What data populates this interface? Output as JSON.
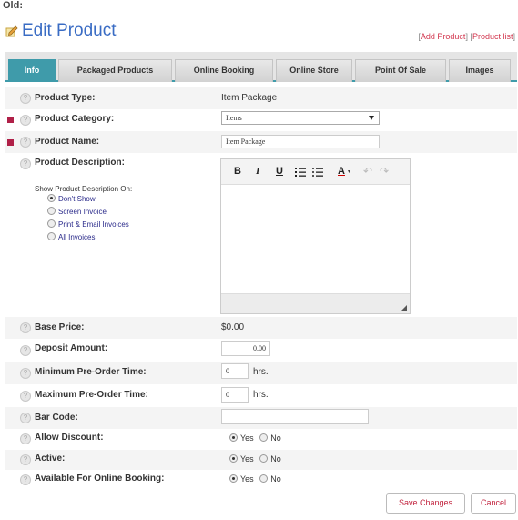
{
  "header": {
    "old_label": "Old:"
  },
  "page": {
    "title": "Edit Product",
    "links": {
      "add_product": "Add Product",
      "product_list": "Product list",
      "open": "[",
      "sep": "] [",
      "close": "]"
    }
  },
  "tabs": [
    {
      "label": "Info",
      "active": true
    },
    {
      "label": "Packaged Products",
      "active": false
    },
    {
      "label": "Online Booking",
      "active": false
    },
    {
      "label": "Online Store",
      "active": false
    },
    {
      "label": "Point Of Sale",
      "active": false
    },
    {
      "label": "Images",
      "active": false
    }
  ],
  "fields": {
    "product_type": {
      "label": "Product Type:",
      "value": "Item Package"
    },
    "product_category": {
      "label": "Product Category:",
      "value": "Items"
    },
    "product_name": {
      "label": "Product Name:",
      "value": "Item Package"
    },
    "product_description": {
      "label": "Product Description:"
    },
    "show_description": {
      "label": "Show Product Description On:",
      "options": [
        "Don't Show",
        "Screen Invoice",
        "Print & Email Invoices",
        "All Invoices"
      ],
      "selected": "Don't Show"
    },
    "base_price": {
      "label": "Base Price:",
      "value": "$0.00"
    },
    "deposit_amount": {
      "label": "Deposit Amount:",
      "value": "0.00"
    },
    "min_preorder": {
      "label": "Minimum Pre-Order Time:",
      "value": "0",
      "unit": "hrs."
    },
    "max_preorder": {
      "label": "Maximum Pre-Order Time:",
      "value": "0",
      "unit": "hrs."
    },
    "bar_code": {
      "label": "Bar Code:",
      "value": ""
    },
    "allow_discount": {
      "label": "Allow Discount:",
      "yes": "Yes",
      "no": "No",
      "selected": "Yes"
    },
    "active": {
      "label": "Active:",
      "yes": "Yes",
      "no": "No",
      "selected": "Yes"
    },
    "online_booking": {
      "label": "Available For Online Booking:",
      "yes": "Yes",
      "no": "No",
      "selected": "Yes"
    }
  },
  "editor_toolbar": {
    "bold": "B",
    "italic": "I",
    "underline": "U",
    "font_color": "A"
  },
  "buttons": {
    "save": "Save Changes",
    "cancel": "Cancel"
  },
  "colors": {
    "accent": "#3f9baa",
    "title": "#3a6cc4",
    "link": "#d2374f",
    "required": "#b02048"
  }
}
